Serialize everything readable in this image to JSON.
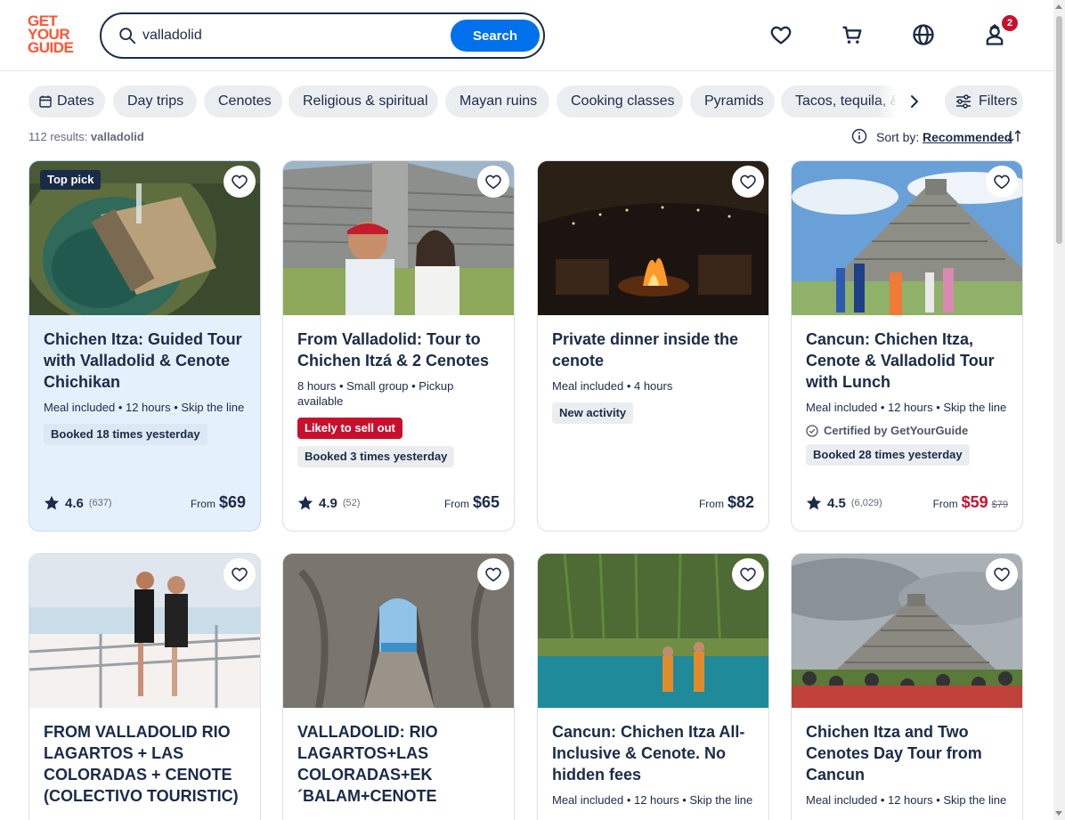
{
  "header": {
    "logo": [
      "GET",
      "YOUR",
      "GUIDE"
    ],
    "search_value": "valladolid",
    "search_button": "Search",
    "notifications_count": "2",
    "icons": [
      "heart-icon",
      "cart-icon",
      "globe-icon",
      "profile-icon"
    ]
  },
  "chips": [
    "Dates",
    "Day trips",
    "Cenotes",
    "Religious & spiritual",
    "Mayan ruins",
    "Cooking classes",
    "Pyramids",
    "Tacos, tequila, &"
  ],
  "filters_label": "Filters",
  "results": {
    "count": "112 results:",
    "query": "valladolid"
  },
  "sort": {
    "label": "Sort by:",
    "value": "Recommended"
  },
  "cards": [
    {
      "badge": "Top pick",
      "title": "Chichen Itza: Guided Tour with Valladolid & Cenote Chichikan",
      "meta": "Meal included • 12 hours • Skip the line",
      "tags": [
        "Booked 18 times yesterday"
      ],
      "rating": "4.6",
      "reviews": "(637)",
      "from": "From",
      "price": "$69"
    },
    {
      "title": "From Valladolid: Tour to Chichen Itzá & 2 Cenotes",
      "meta": "8 hours • Small group • Pickup available",
      "red_tag": "Likely to sell out",
      "tags": [
        "Booked 3 times yesterday"
      ],
      "rating": "4.9",
      "reviews": "(52)",
      "from": "From",
      "price": "$65"
    },
    {
      "title": "Private dinner inside the cenote",
      "meta": "Meal included • 4 hours",
      "tags": [
        "New activity"
      ],
      "from": "From",
      "price": "$82"
    },
    {
      "title": "Cancun: Chichen Itza, Cenote & Valladolid Tour with Lunch",
      "meta": "Meal included • 12 hours • Skip the line",
      "certified": "Certified by GetYourGuide",
      "tags": [
        "Booked 28 times yesterday"
      ],
      "rating": "4.5",
      "reviews": "(6,029)",
      "from": "From",
      "price": "$59",
      "old_price": "$79"
    },
    {
      "title": "FROM VALLADOLID RIO LAGARTOS + LAS COLORADAS + CENOTE (COLECTIVO TOURISTIC)"
    },
    {
      "title": "VALLADOLID: RIO LAGARTOS+LAS COLORADAS+EK ´BALAM+CENOTE"
    },
    {
      "title": "Cancun: Chichen Itza All-Inclusive & Cenote. No hidden fees",
      "meta": "Meal included • 12 hours • Skip the line"
    },
    {
      "title": "Chichen Itza and Two Cenotes Day Tour from Cancun",
      "meta": "Meal included • 12 hours • Skip the line"
    }
  ],
  "colors": {
    "brand": "#ff5533",
    "primary": "#0071eb",
    "text": "#1a2b49",
    "sale": "#c8102e"
  }
}
